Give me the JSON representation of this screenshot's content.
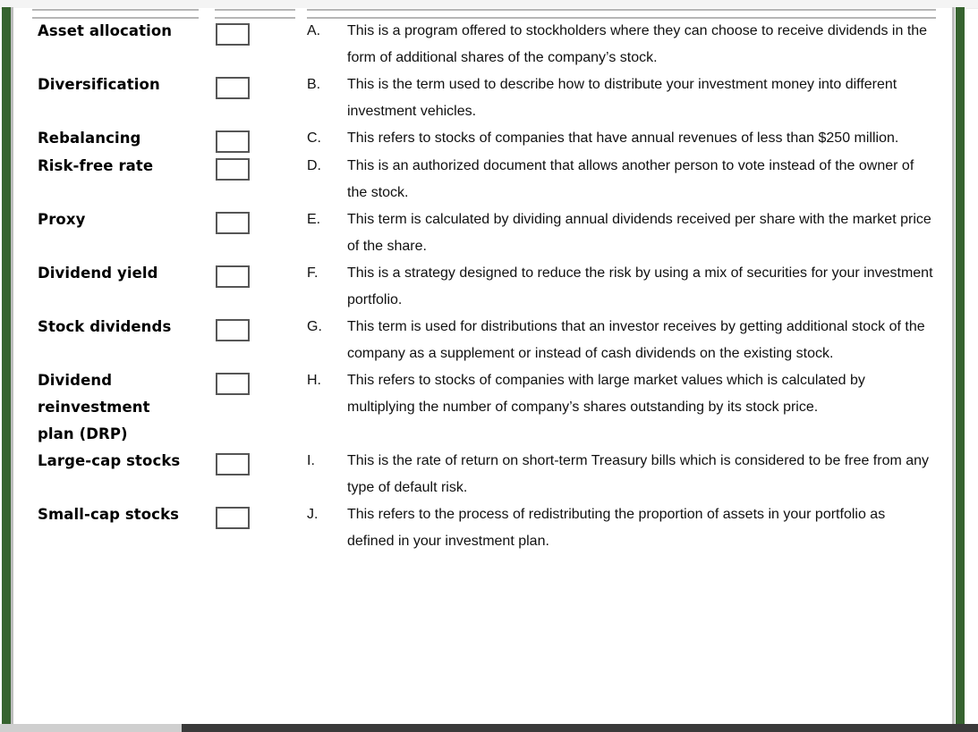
{
  "document": {
    "type": "matching-exercise-worksheet",
    "accent_color": "#36632f",
    "rule_color": "#b6b6b6",
    "box_border_color": "#565656",
    "text_color": "#111111"
  },
  "rows": [
    {
      "term": "Asset allocation",
      "term_lines": [
        "Asset allocation"
      ],
      "answer_box_value": "",
      "letter": "A.",
      "definition": "This is a program offered to stockholders where they can choose to receive dividends in the form of additional shares of the company’s stock."
    },
    {
      "term": "Diversification",
      "term_lines": [
        "Diversification"
      ],
      "answer_box_value": "",
      "letter": "B.",
      "definition": "This is the term used to describe how to distribute your investment money into different investment vehicles."
    },
    {
      "term": "Rebalancing",
      "term_lines": [
        "Rebalancing"
      ],
      "answer_box_value": "",
      "letter": "C.",
      "definition": "This refers to stocks of companies that have annual revenues of less than $250 million."
    },
    {
      "term": "Risk-free rate",
      "term_lines": [
        "Risk-free rate"
      ],
      "answer_box_value": "",
      "letter": "D.",
      "definition": "This is an authorized document that allows another person to vote instead of the owner of the stock."
    },
    {
      "term": "Proxy",
      "term_lines": [
        "Proxy"
      ],
      "answer_box_value": "",
      "letter": "E.",
      "definition": "This term is calculated by dividing annual dividends received per share with the market price of the share."
    },
    {
      "term": "Dividend yield",
      "term_lines": [
        "Dividend yield"
      ],
      "answer_box_value": "",
      "letter": "F.",
      "definition": "This is a strategy designed to reduce the risk by using a mix of securities for your investment portfolio."
    },
    {
      "term": "Stock dividends",
      "term_lines": [
        "Stock dividends"
      ],
      "answer_box_value": "",
      "letter": "G.",
      "definition": "This term is used for distributions that an investor receives by getting additional stock of the company as a supplement or instead of cash dividends on the existing stock."
    },
    {
      "term": "Dividend reinvestment plan (DRP)",
      "term_lines": [
        "Dividend",
        "reinvestment",
        "plan (DRP)"
      ],
      "answer_box_value": "",
      "letter": "H.",
      "definition": "This refers to stocks of companies with large market values which is calculated by multiplying the number of company’s shares outstanding by its stock price."
    },
    {
      "term": "Large-cap stocks",
      "term_lines": [
        "Large-cap stocks"
      ],
      "answer_box_value": "",
      "letter": "I.",
      "definition": "This is the rate of return on short-term Treasury bills which is considered to be free from any type of default risk."
    },
    {
      "term": "Small-cap stocks",
      "term_lines": [
        "Small-cap stocks"
      ],
      "answer_box_value": "",
      "letter": "J.",
      "definition": "This refers to the process of redistributing the proportion of assets in your portfolio as defined in your investment plan."
    }
  ]
}
